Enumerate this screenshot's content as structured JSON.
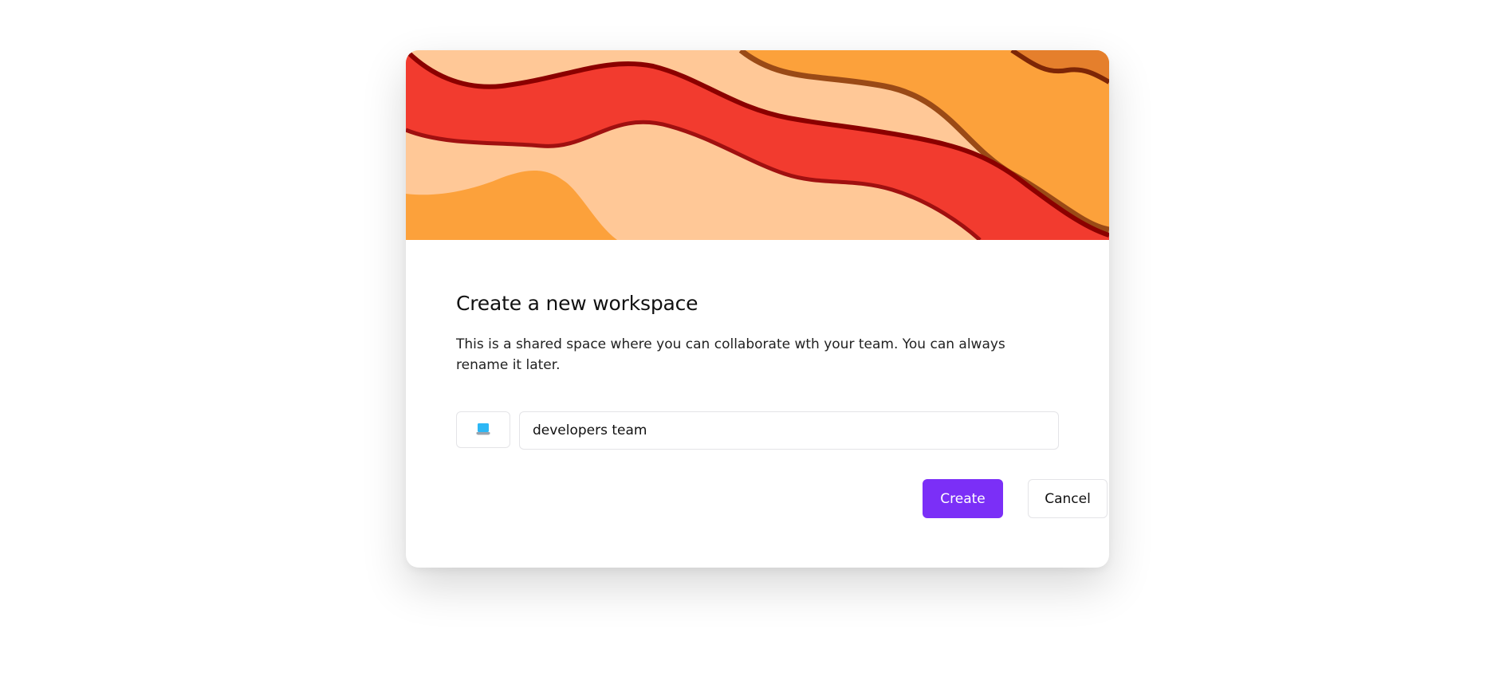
{
  "colors": {
    "accent": "#7b2ff7",
    "banner_red": "#f23b2f",
    "banner_peach": "#ffc897",
    "banner_orange": "#fca13b",
    "banner_dark_red": "#8b0000"
  },
  "modal": {
    "title": "Create a new workspace",
    "description": "This is a shared space where you can collaborate wth your team. You can always rename it later.",
    "icon_picker": {
      "icon": "laptop-icon",
      "glyph": "💻"
    },
    "name_input": {
      "value": "developers team"
    },
    "create_label": "Create",
    "cancel_label": "Cancel"
  }
}
